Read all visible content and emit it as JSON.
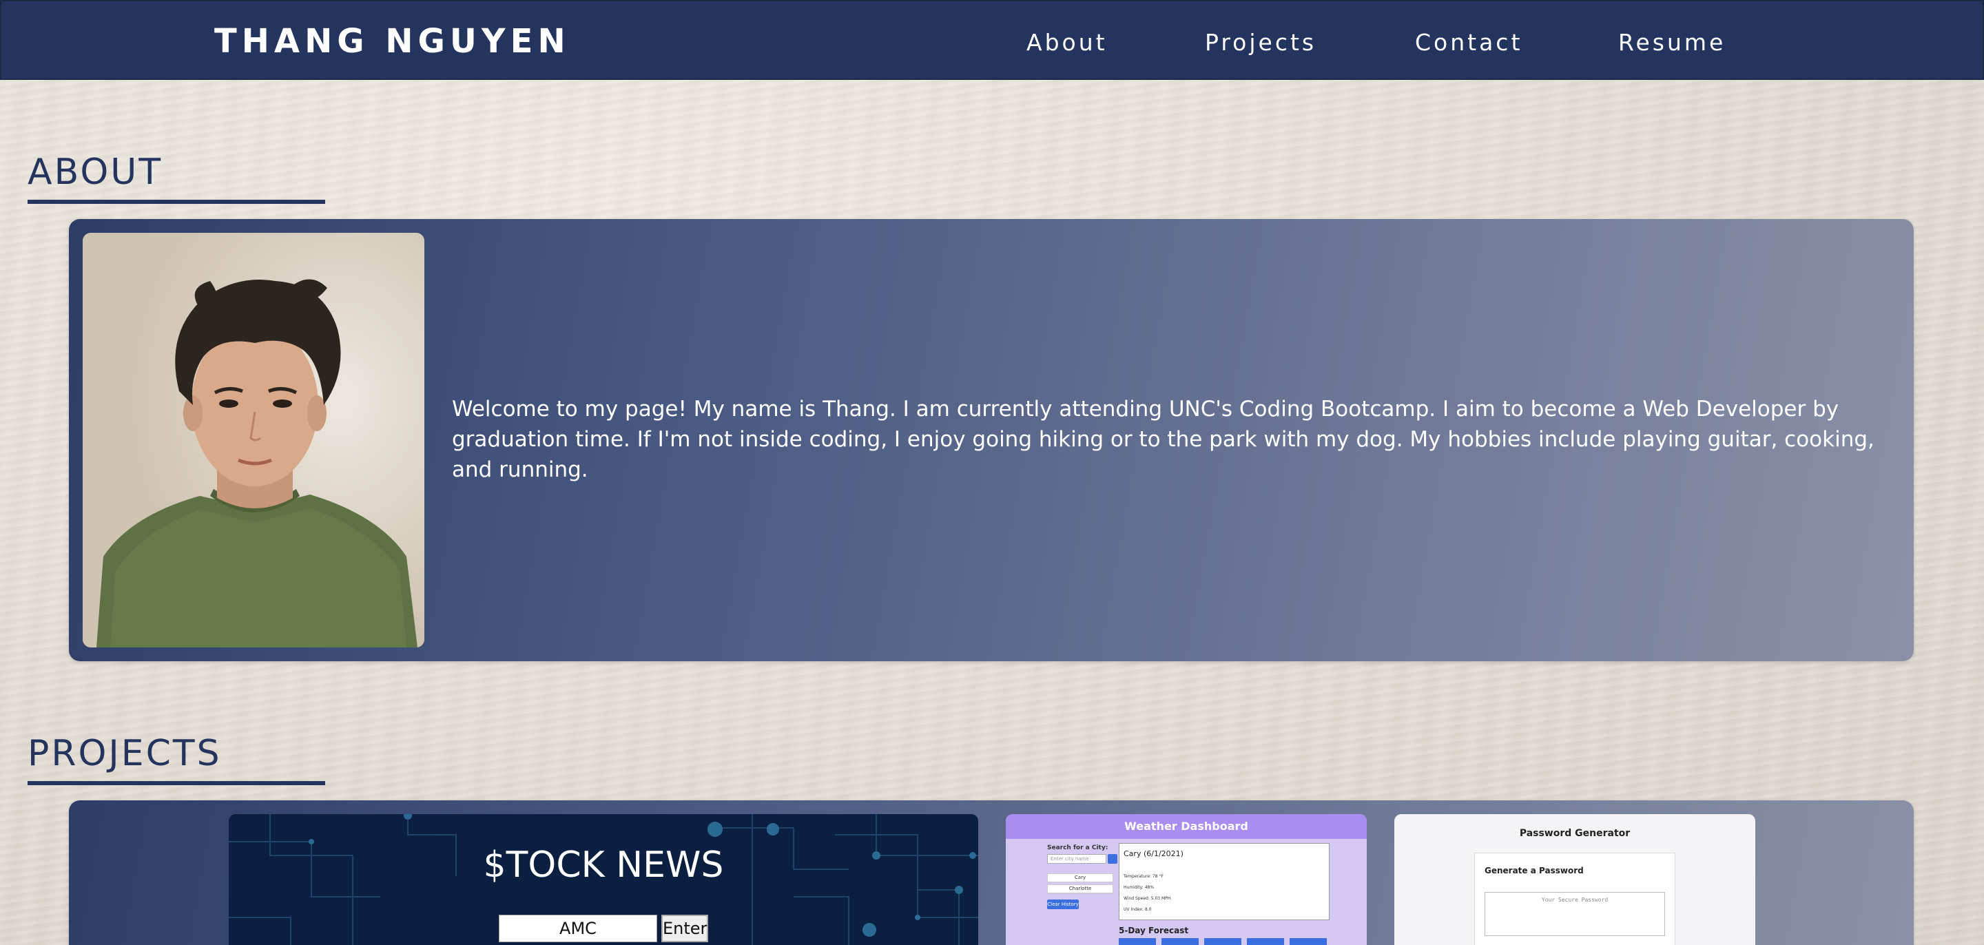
{
  "header": {
    "brand": "THANG NGUYEN",
    "nav": [
      {
        "label": "About"
      },
      {
        "label": "Projects"
      },
      {
        "label": "Contact"
      },
      {
        "label": "Resume"
      }
    ]
  },
  "about": {
    "title": "ABOUT",
    "text": "Welcome to my page! My name is Thang. I am currently attending UNC's Coding Bootcamp. I aim to become a Web Developer by graduation time. If I'm not inside coding, I enjoy going hiking or to the park with my dog. My hobbies include playing guitar, cooking, and running."
  },
  "projects": {
    "title": "PROJECTS",
    "stock": {
      "title": "$TOCK NEWS",
      "input_value": "AMC",
      "button_label": "Enter"
    },
    "weather": {
      "header": "Weather Dashboard",
      "search_label": "Search for a City:",
      "search_placeholder": "Enter city name",
      "cities": [
        "Cary",
        "Charlotte"
      ],
      "clear_label": "Clear History",
      "current_title": "Cary (6/1/2021)",
      "lines": [
        "Temperature: 78 °F",
        "Humidity: 48%",
        "Wind Speed: 5.03 MPH",
        "UV Index: 8.0"
      ],
      "forecast_title": "5-Day Forecast"
    },
    "password": {
      "title": "Password Generator",
      "subtitle": "Generate a Password",
      "placeholder": "Your Secure Password"
    }
  },
  "colors": {
    "navy": "#23345f",
    "paper": "#e9e3d9",
    "white": "#ffffff"
  }
}
